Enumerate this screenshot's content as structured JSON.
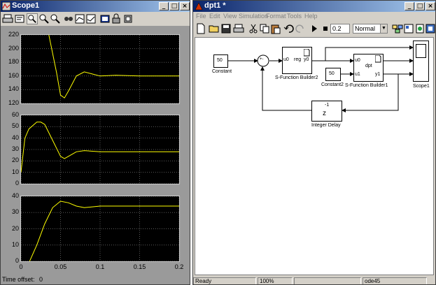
{
  "scope_window": {
    "title": "Scope1",
    "time_offset_label": "Time offset:",
    "time_offset_value": "0",
    "toolbar_icons": [
      "print-icon",
      "parameters-icon",
      "zoom-icon",
      "zoom-x-icon",
      "zoom-y-icon",
      "autoscale-icon",
      "save-axes-icon",
      "restore-axes-icon",
      "floating-scope-icon",
      "lock-axes-icon",
      "signal-selection-icon"
    ],
    "x_ticks": [
      "0",
      "0.05",
      "0.1",
      "0.15",
      "0.2"
    ]
  },
  "model_window": {
    "title": "dpt1 *",
    "menu": [
      "File",
      "Edit",
      "View",
      "Simulation",
      "Format",
      "Tools",
      "Help"
    ],
    "stop_time": "0.2",
    "sim_mode": "Normal",
    "status_ready": "Ready",
    "status_zoom": "100%",
    "status_solver": "ode45",
    "toolbar_icons": [
      "new-icon",
      "open-icon",
      "save-icon",
      "print-icon",
      "cut-icon",
      "copy-icon",
      "paste-icon",
      "undo-icon",
      "redo-icon",
      "start-icon",
      "stop-icon",
      "library-browser-icon",
      "model-explorer-icon",
      "debugger-icon",
      "help-icon"
    ],
    "blocks": {
      "constant": {
        "value": "50",
        "label": "Constant"
      },
      "sum": {
        "signs": "+-"
      },
      "sfb2": {
        "in": "u0",
        "mid": "reg",
        "out": "y0",
        "label": "S-Function Builder2"
      },
      "constant2": {
        "value": "50",
        "label": "Constant2"
      },
      "sfb1": {
        "in0": "u0",
        "in1": "u1",
        "mid": "dpt",
        "out": "y1",
        "label": "S-Function Builder1"
      },
      "scope1": {
        "label": "Scope1"
      },
      "delay": {
        "num": "-1",
        "den": "z",
        "label": "Integer Delay"
      }
    }
  },
  "colors": {
    "trace": "#ffff00",
    "title_active": "#0a246a",
    "axes_bg": "#000000",
    "chrome": "#d4d0c8"
  },
  "chart_data": [
    {
      "type": "line",
      "title": "",
      "xlim": [
        0,
        0.2
      ],
      "ylim": [
        120,
        220
      ],
      "y_ticks": [
        "120",
        "140",
        "160",
        "180",
        "200",
        "220"
      ],
      "x": [
        0,
        0.02,
        0.035,
        0.045,
        0.05,
        0.055,
        0.06,
        0.07,
        0.08,
        0.09,
        0.1,
        0.12,
        0.15,
        0.2
      ],
      "series": [
        {
          "values": [
            222,
            222,
            221,
            165,
            132,
            128,
            138,
            160,
            166,
            163,
            160,
            161,
            160,
            160
          ]
        }
      ]
    },
    {
      "type": "line",
      "title": "",
      "xlim": [
        0,
        0.2
      ],
      "ylim": [
        0,
        60
      ],
      "y_ticks": [
        "0",
        "10",
        "20",
        "30",
        "40",
        "50",
        "60"
      ],
      "x": [
        0,
        0.005,
        0.01,
        0.02,
        0.025,
        0.03,
        0.04,
        0.05,
        0.055,
        0.06,
        0.07,
        0.08,
        0.1,
        0.12,
        0.15,
        0.2
      ],
      "series": [
        {
          "values": [
            10,
            40,
            48,
            54,
            54,
            52,
            38,
            24,
            22,
            24,
            28,
            29,
            28,
            28,
            28,
            28
          ]
        }
      ]
    },
    {
      "type": "line",
      "title": "",
      "xlim": [
        0,
        0.2
      ],
      "ylim": [
        0,
        40
      ],
      "y_ticks": [
        "0",
        "10",
        "20",
        "30",
        "40"
      ],
      "x": [
        0,
        0.005,
        0.01,
        0.02,
        0.03,
        0.04,
        0.05,
        0.06,
        0.07,
        0.08,
        0.1,
        0.12,
        0.15,
        0.2
      ],
      "series": [
        {
          "values": [
            -3,
            -3,
            -1,
            10,
            23,
            33,
            37,
            36,
            34,
            33,
            34,
            34,
            34,
            34
          ]
        }
      ]
    }
  ]
}
